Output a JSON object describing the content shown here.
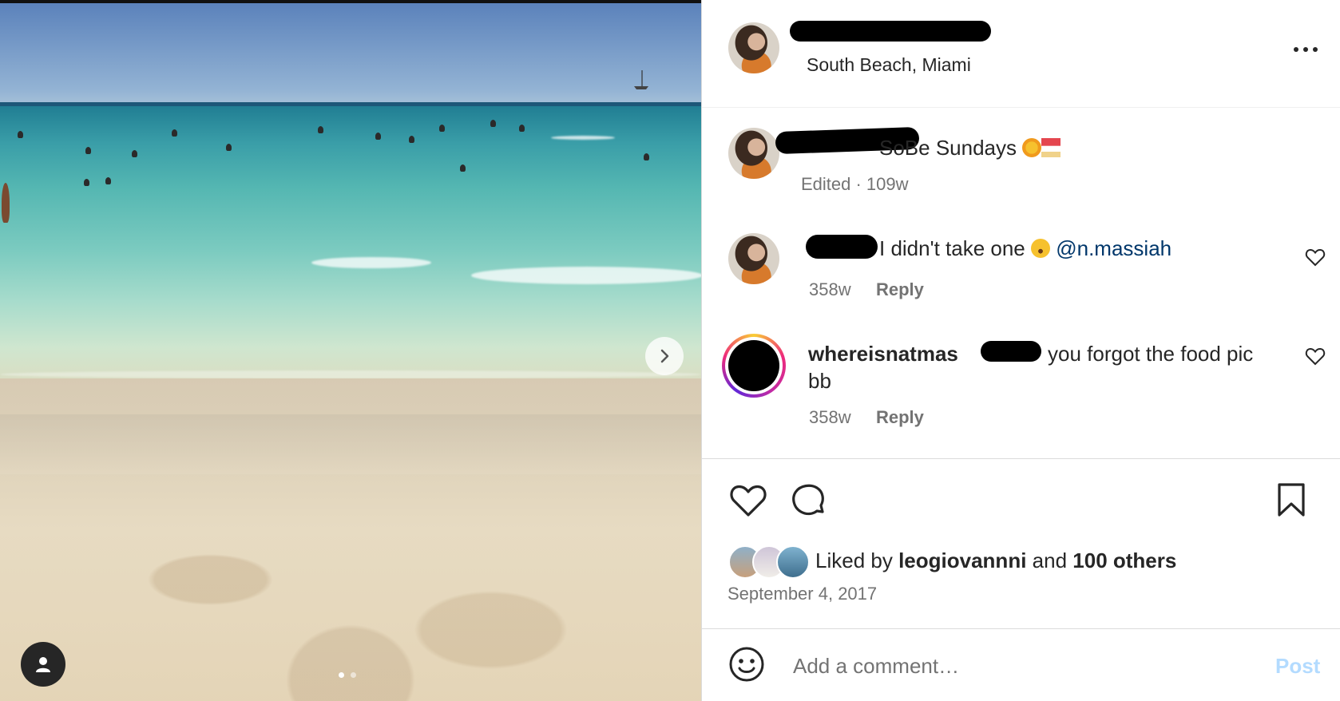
{
  "post": {
    "location": "South Beach, Miami",
    "more_icon": "more-horizontal-icon",
    "caption": {
      "text": "SoBe Sundays",
      "emojis": [
        "sun-emoji",
        "beach-umbrella-emoji"
      ],
      "meta": "Edited · 109w"
    },
    "comments": [
      {
        "text": "I didn't take one",
        "emoji": "weary-face-emoji",
        "mention": "@n.massiah",
        "age": "358w",
        "reply_label": "Reply"
      },
      {
        "username": "whereisnatmas",
        "text_line1": "you forgot the food pic",
        "text_line2": "bb",
        "age": "358w",
        "reply_label": "Reply"
      }
    ],
    "likes": {
      "prefix": "Liked by",
      "user": "leogiovannni",
      "connector": "and",
      "others": "100 others"
    },
    "date": "September 4, 2017",
    "composer": {
      "placeholder": "Add a comment…",
      "post_label": "Post"
    }
  },
  "colors": {
    "mention": "#00376b",
    "secondary_text": "#737373",
    "post_disabled": "#b3dbff"
  }
}
